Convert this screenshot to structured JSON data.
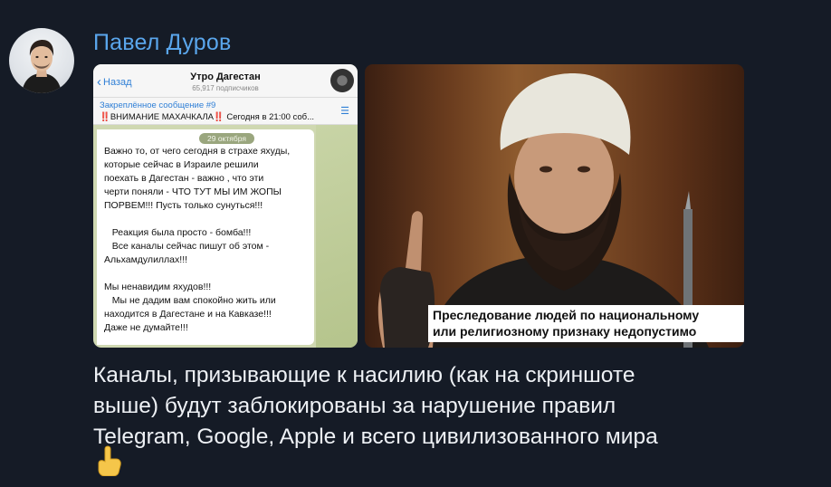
{
  "message": {
    "sender_name": "Павел Дуров",
    "avatar_icon": "user-avatar-photo",
    "screenshot": {
      "back_label": "Назад",
      "channel_title": "Утро Дагестан",
      "subscribers": "65,917 подписчиков",
      "pinned_title": "Закреплённое сообщение #9",
      "pinned_text": "‼️ВНИМАНИЕ МАХАЧКАЛА‼️ Сегодня в 21:00 соб...",
      "date": "29 октября",
      "body_lines": [
        "Важно то, от чего сегодня в страхе яхуды,",
        "которые сейчас в Израиле решили",
        "поехать в Дагестан - важно , что эти",
        "черти поняли - ЧТО ТУТ МЫ ИМ ЖОПЫ",
        "ПОРВЕМ!!! Пусть только сунуться!!!",
        "",
        "   Реакция была просто - бомба!!!",
        "   Все каналы сейчас пишут об этом -",
        "Альхамдулиллах!!!",
        "",
        "Мы ненавидим яхудов!!!",
        "   Мы не дадим вам спокойно жить или",
        "находится в Дагестане и на Кавказе!!!",
        "Даже не думайте!!!"
      ]
    },
    "meme_caption_lines": [
      "Преследование людей по национальному",
      "или религиозному признаку недопустимо"
    ],
    "text_lines": [
      "Каналы, призывающие к насилию (как на скриншоте",
      "выше) будут заблокированы за нарушение правил",
      "Telegram, Google, Apple и всего цивилизованного мира"
    ],
    "emoji": "pointing-up-emoji"
  },
  "colors": {
    "background": "#151b26",
    "sender_name": "#5aa6ec",
    "message_text": "#eef1f5",
    "link_blue": "#2f7fd6"
  }
}
